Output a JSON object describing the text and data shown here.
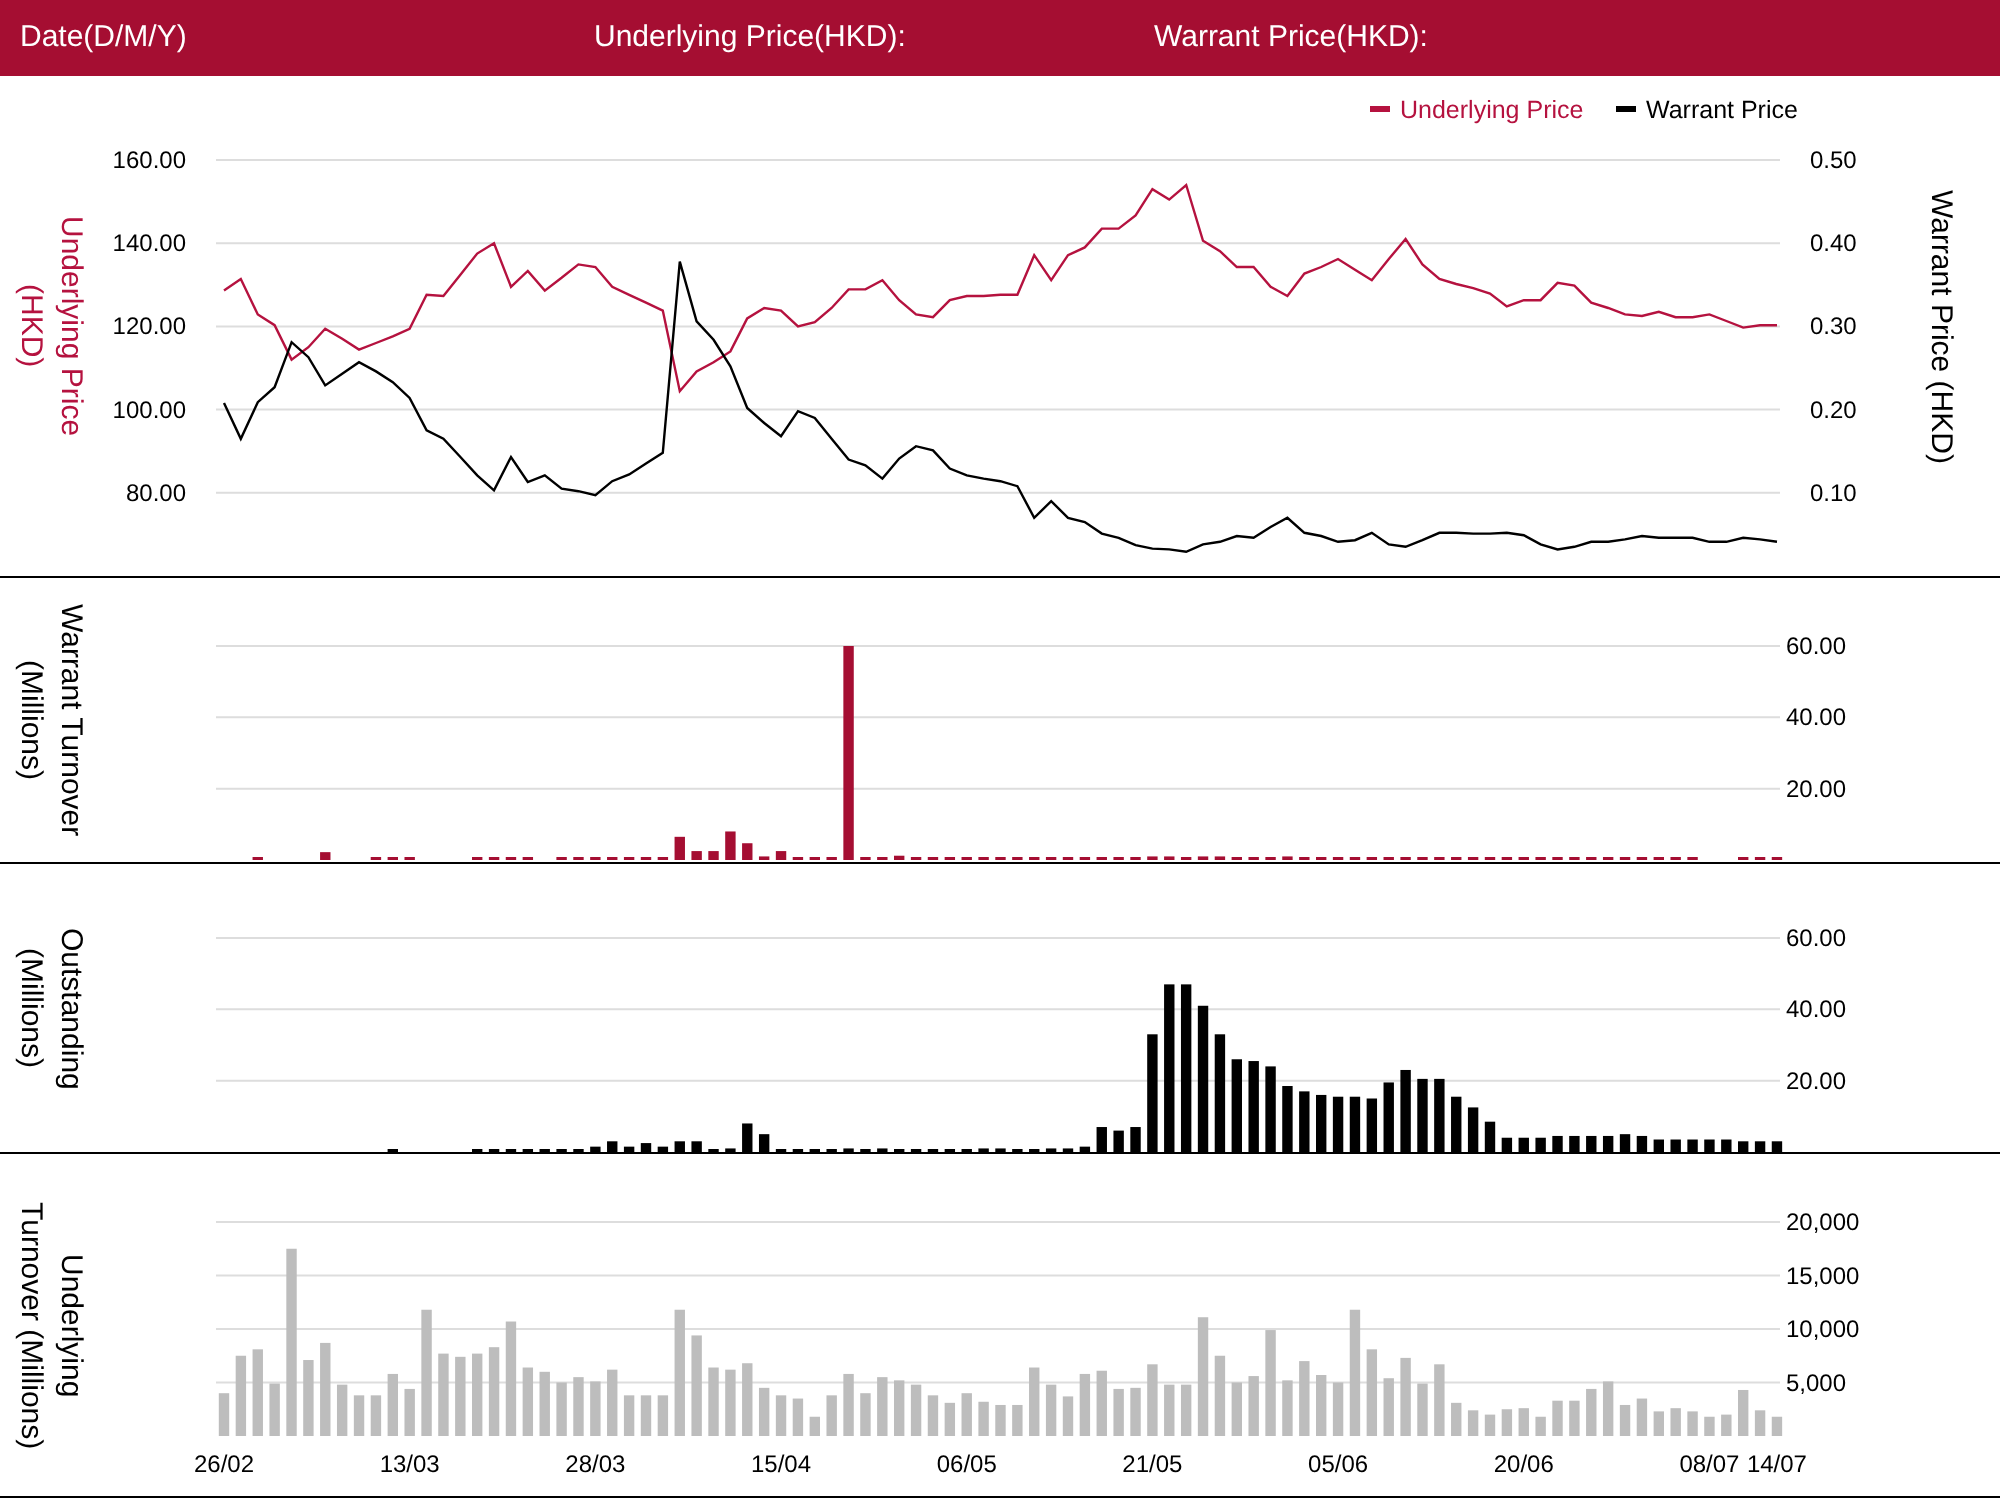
{
  "header": {
    "fields": [
      "Date(D/M/Y)",
      "Underlying Price(HKD):",
      "Warrant Price(HKD):"
    ]
  },
  "panels": [
    {
      "chart_data": {
        "type": "line",
        "grid": true,
        "legend": true,
        "ylabel": "Underlying Price (HKD)",
        "y2label": "Warrant  Price (HKD)",
        "ylim": [
          60,
          160
        ],
        "y2lim": [
          0,
          0.5
        ],
        "yticks": [
          {
            "value": 80,
            "label": "80.00"
          },
          {
            "value": 100,
            "label": "100.00"
          },
          {
            "value": 120,
            "label": "120.00"
          },
          {
            "value": 140,
            "label": "140.00"
          },
          {
            "value": 160,
            "label": "160.00"
          }
        ],
        "y2ticks": [
          {
            "value": 0.1,
            "label": "0.10"
          },
          {
            "value": 0.2,
            "label": "0.20"
          },
          {
            "value": 0.3,
            "label": "0.30"
          },
          {
            "value": 0.4,
            "label": "0.40"
          },
          {
            "value": 0.5,
            "label": "0.50"
          }
        ],
        "series": [
          {
            "name": "Underlying Price",
            "color": "#b5123f",
            "values": [
              128.6,
              131.4,
              122.9,
              120.3,
              112,
              115,
              119.4,
              117,
              114.4,
              116,
              117.6,
              119.4,
              127.6,
              127.3,
              132.4,
              137.5,
              140,
              129.5,
              133.3,
              128.6,
              131.7,
              134.9,
              134.3,
              129.5,
              127.6,
              125.7,
              123.8,
              104.4,
              109.2,
              111.4,
              114,
              121.9,
              124.4,
              123.8,
              120,
              121,
              124.4,
              128.9,
              128.9,
              131.1,
              126.3,
              122.9,
              122.2,
              126.3,
              127.3,
              127.3,
              127.6,
              127.6,
              137.1,
              131.1,
              137.1,
              139,
              143.5,
              143.5,
              146.7,
              153,
              150.5,
              154,
              140.6,
              138.1,
              134.3,
              134.3,
              129.5,
              127.3,
              132.7,
              134.3,
              136.2,
              133.6,
              131.1,
              136.2,
              141,
              134.9,
              131.4,
              130.2,
              129.2,
              127.9,
              124.8,
              126.3,
              126.3,
              130.5,
              129.8,
              125.7,
              124.4,
              122.9,
              122.5,
              123.5,
              122.2,
              122.2,
              122.9,
              121.3,
              119.7,
              120.3,
              120.3
            ]
          },
          {
            "name": "Warrant Price",
            "color": "#000000",
            "axis": "y2",
            "values": [
              0.208,
              0.165,
              0.209,
              0.227,
              0.281,
              0.263,
              0.229,
              0.243,
              0.257,
              0.246,
              0.233,
              0.214,
              0.175,
              0.165,
              0.143,
              0.121,
              0.103,
              0.143,
              0.113,
              0.121,
              0.105,
              0.102,
              0.097,
              0.114,
              0.122,
              0.135,
              0.148,
              0.378,
              0.306,
              0.284,
              0.252,
              0.202,
              0.184,
              0.168,
              0.198,
              0.19,
              0.165,
              0.14,
              0.133,
              0.117,
              0.141,
              0.156,
              0.151,
              0.129,
              0.121,
              0.117,
              0.114,
              0.108,
              0.07,
              0.09,
              0.07,
              0.065,
              0.051,
              0.046,
              0.037,
              0.033,
              0.032,
              0.029,
              0.038,
              0.041,
              0.048,
              0.046,
              0.059,
              0.07,
              0.052,
              0.048,
              0.041,
              0.043,
              0.052,
              0.038,
              0.035,
              0.043,
              0.052,
              0.052,
              0.051,
              0.051,
              0.052,
              0.049,
              0.038,
              0.032,
              0.035,
              0.041,
              0.041,
              0.044,
              0.048,
              0.046,
              0.046,
              0.046,
              0.041,
              0.041,
              0.046,
              0.044,
              0.041
            ]
          }
        ]
      }
    },
    {
      "chart_data": {
        "type": "bar",
        "grid": true,
        "ylabel": "Warrant  Turnover (Millions)",
        "ylim": [
          0,
          60
        ],
        "yticks": [
          {
            "value": 20,
            "label": "20.00"
          },
          {
            "value": 40,
            "label": "40.00"
          },
          {
            "value": 60,
            "label": "60.00"
          }
        ],
        "series": [
          {
            "color": "#a50e32",
            "values": [
              0,
              0,
              0.5,
              0,
              0,
              0,
              2.2,
              0,
              0,
              0.5,
              0.5,
              0.5,
              0,
              0,
              0,
              0.5,
              0.5,
              0.5,
              0.5,
              0,
              0.5,
              0.5,
              0.5,
              0.5,
              0.5,
              0.5,
              0.5,
              6.5,
              2.5,
              2.5,
              8,
              4.7,
              1,
              2.5,
              0.5,
              0.5,
              0.5,
              60,
              0.5,
              0.5,
              1.2,
              0.8,
              0.8,
              0.5,
              0.5,
              0.5,
              0.5,
              0.5,
              0.5,
              0.5,
              0.5,
              0.5,
              0.5,
              0.5,
              0.5,
              1,
              1,
              0.5,
              1,
              1,
              0.5,
              0.5,
              0.5,
              1,
              0.5,
              0.5,
              0.5,
              0.5,
              0.5,
              0.5,
              0.5,
              0.5,
              0.5,
              0.5,
              0.5,
              0.5,
              0.5,
              0.5,
              0.5,
              0.5,
              0.5,
              0.5,
              0.5,
              0.5,
              0.5,
              0.5,
              0.5,
              0.5,
              0,
              0,
              0.5,
              0.5,
              0.5
            ]
          }
        ]
      }
    },
    {
      "chart_data": {
        "type": "bar",
        "grid": true,
        "ylabel": "Outstanding (Millions)",
        "ylim": [
          0,
          60
        ],
        "yticks": [
          {
            "value": 20,
            "label": "20.00"
          },
          {
            "value": 40,
            "label": "40.00"
          },
          {
            "value": 60,
            "label": "60.00"
          }
        ],
        "series": [
          {
            "color": "#000000",
            "values": [
              0,
              0,
              0,
              0,
              0,
              0,
              0,
              0,
              0,
              0,
              0.5,
              0,
              0,
              0,
              0,
              0.5,
              0.5,
              0.5,
              0.5,
              0.5,
              0.5,
              0.5,
              1.5,
              3,
              1.5,
              2.5,
              1.5,
              3,
              3,
              0.5,
              1,
              8,
              5,
              0.5,
              0.5,
              0.5,
              0.5,
              1,
              0.5,
              1,
              0.5,
              0.5,
              0.5,
              0.5,
              0.5,
              1,
              1,
              0.5,
              0.5,
              1,
              1,
              1.5,
              7,
              6,
              7,
              33,
              47,
              47,
              41,
              33,
              26,
              25.5,
              24,
              18.5,
              17,
              16,
              15.5,
              15.5,
              15,
              19.5,
              23,
              20.5,
              20.5,
              15.5,
              12.5,
              8.5,
              4,
              4,
              4,
              4.5,
              4.5,
              4.5,
              4.5,
              5,
              4.5,
              3.5,
              3.5,
              3.5,
              3.5,
              3.5,
              3,
              3,
              3
            ]
          }
        ]
      }
    },
    {
      "chart_data": {
        "type": "bar",
        "grid": true,
        "ylabel": "Underlying Turnover (Millions)",
        "ylim": [
          0,
          20000
        ],
        "yticks": [
          {
            "value": 5000,
            "label": "5,000"
          },
          {
            "value": 10000,
            "label": "10,000"
          },
          {
            "value": 15000,
            "label": "15,000"
          },
          {
            "value": 20000,
            "label": "20,000"
          }
        ],
        "categories": [
          "26/02",
          null,
          null,
          null,
          null,
          null,
          null,
          null,
          null,
          null,
          null,
          "13/03",
          null,
          null,
          null,
          null,
          null,
          null,
          null,
          null,
          null,
          null,
          "28/03",
          null,
          null,
          null,
          null,
          null,
          null,
          null,
          null,
          null,
          null,
          "15/04",
          null,
          null,
          null,
          null,
          null,
          null,
          null,
          null,
          null,
          null,
          "06/05",
          null,
          null,
          null,
          null,
          null,
          null,
          null,
          null,
          null,
          null,
          "21/05",
          null,
          null,
          null,
          null,
          null,
          null,
          null,
          null,
          null,
          null,
          "05/06",
          null,
          null,
          null,
          null,
          null,
          null,
          null,
          null,
          null,
          null,
          "20/06",
          null,
          null,
          null,
          null,
          null,
          null,
          null,
          null,
          null,
          null,
          "08/07",
          null,
          null,
          null,
          "14/07"
        ],
        "series": [
          {
            "color": "#bdbdbd",
            "values": [
              4000,
              7500,
              8100,
              4900,
              17500,
              7100,
              8700,
              4800,
              3800,
              3800,
              5800,
              4400,
              11800,
              7700,
              7400,
              7700,
              8300,
              10700,
              6400,
              6000,
              5000,
              5500,
              5100,
              6200,
              3800,
              3800,
              3800,
              11800,
              9400,
              6400,
              6200,
              6800,
              4500,
              3800,
              3500,
              1800,
              3800,
              5800,
              4000,
              5500,
              5200,
              4800,
              3800,
              3100,
              4000,
              3200,
              2900,
              2900,
              6400,
              4800,
              3700,
              5800,
              6100,
              4400,
              4500,
              6700,
              4800,
              4800,
              11100,
              7500,
              5000,
              5600,
              9900,
              5200,
              7000,
              5700,
              5000,
              11800,
              8100,
              5400,
              7300,
              4900,
              6700,
              3100,
              2400,
              2000,
              2500,
              2600,
              1800,
              3300,
              3300,
              4400,
              5100,
              2900,
              3500,
              2300,
              2600,
              2300,
              1800,
              2000,
              4300,
              2400,
              1800
            ]
          }
        ]
      }
    }
  ]
}
